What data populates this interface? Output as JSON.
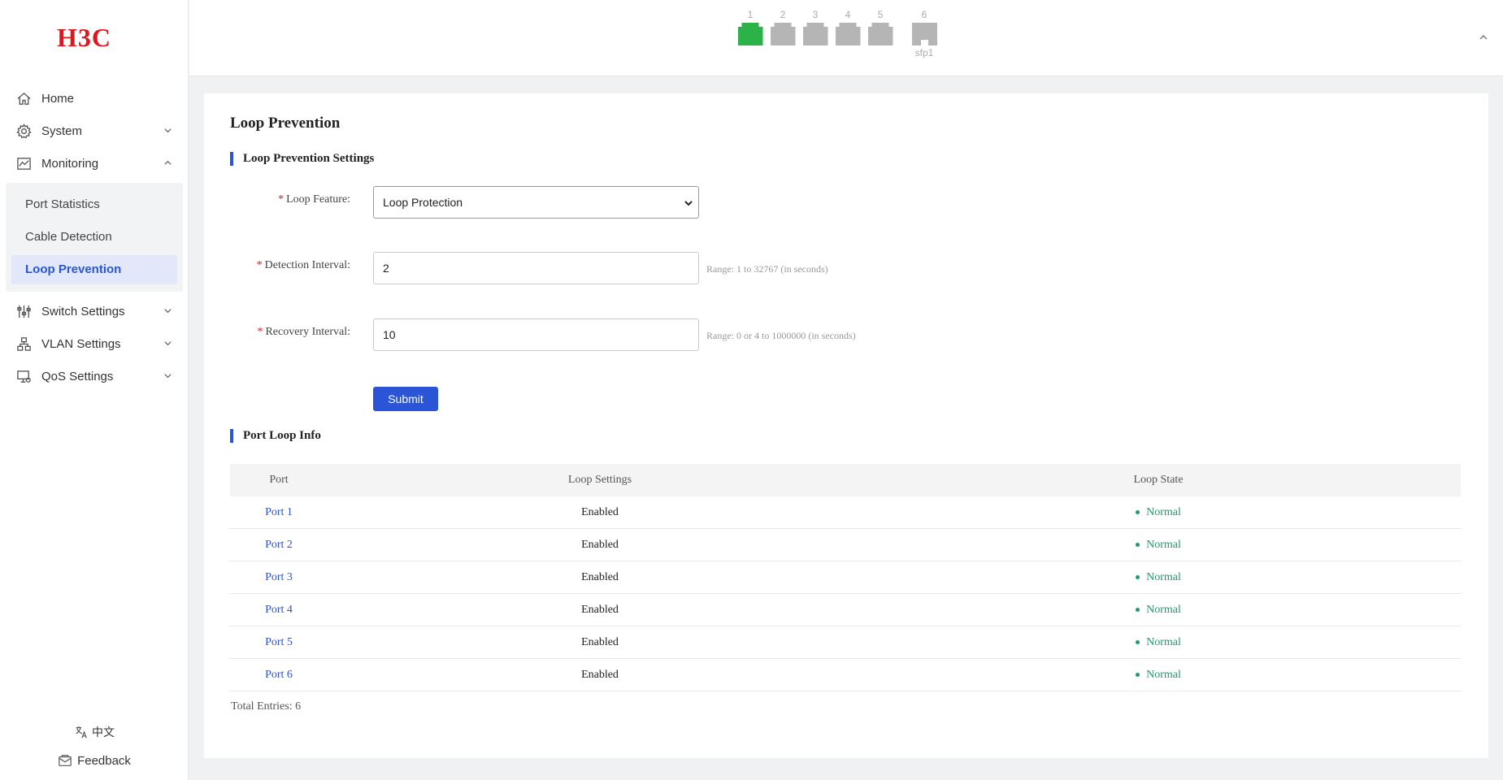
{
  "brand": {
    "logo": "H3C"
  },
  "sidebar": {
    "items": [
      {
        "label": "Home",
        "icon": "home-icon"
      },
      {
        "label": "System",
        "icon": "gear-icon"
      },
      {
        "label": "Monitoring",
        "icon": "chart-icon"
      },
      {
        "label": "Switch Settings",
        "icon": "sliders-icon"
      },
      {
        "label": "VLAN Settings",
        "icon": "network-icon"
      },
      {
        "label": "QoS Settings",
        "icon": "monitor-icon"
      }
    ],
    "monitoring_sub": [
      {
        "label": "Port Statistics"
      },
      {
        "label": "Cable Detection"
      },
      {
        "label": "Loop Prevention"
      }
    ],
    "language": "中文",
    "feedback": "Feedback"
  },
  "header": {
    "ports": [
      {
        "num": "1",
        "status": "up"
      },
      {
        "num": "2",
        "status": "down"
      },
      {
        "num": "3",
        "status": "down"
      },
      {
        "num": "4",
        "status": "down"
      },
      {
        "num": "5",
        "status": "down"
      },
      {
        "num": "6",
        "status": "down",
        "label": "sfp1"
      }
    ]
  },
  "page": {
    "title": "Loop Prevention",
    "settings_title": "Loop Prevention Settings",
    "loop_feature": {
      "label": "Loop Feature:",
      "value": "Loop Protection"
    },
    "detection_interval": {
      "label": "Detection Interval:",
      "value": "2",
      "hint": "Range: 1 to 32767 (in seconds)"
    },
    "recovery_interval": {
      "label": "Recovery Interval:",
      "value": "10",
      "hint": "Range: 0 or 4 to 1000000 (in seconds)"
    },
    "required_mark": "*",
    "submit": "Submit",
    "table_title": "Port Loop Info",
    "columns": {
      "port": "Port",
      "settings": "Loop Settings",
      "state": "Loop State"
    },
    "rows": [
      {
        "port": "Port 1",
        "settings": "Enabled",
        "state": "Normal"
      },
      {
        "port": "Port 2",
        "settings": "Enabled",
        "state": "Normal"
      },
      {
        "port": "Port 3",
        "settings": "Enabled",
        "state": "Normal"
      },
      {
        "port": "Port 4",
        "settings": "Enabled",
        "state": "Normal"
      },
      {
        "port": "Port 5",
        "settings": "Enabled",
        "state": "Normal"
      },
      {
        "port": "Port 6",
        "settings": "Enabled",
        "state": "Normal"
      }
    ],
    "total": "Total Entries: 6"
  },
  "colors": {
    "accent": "#2955d6",
    "brand": "#e0161e",
    "port_up": "#2bb34a",
    "port_down": "#b5b5b5",
    "state_ok": "#1f9a6a"
  }
}
